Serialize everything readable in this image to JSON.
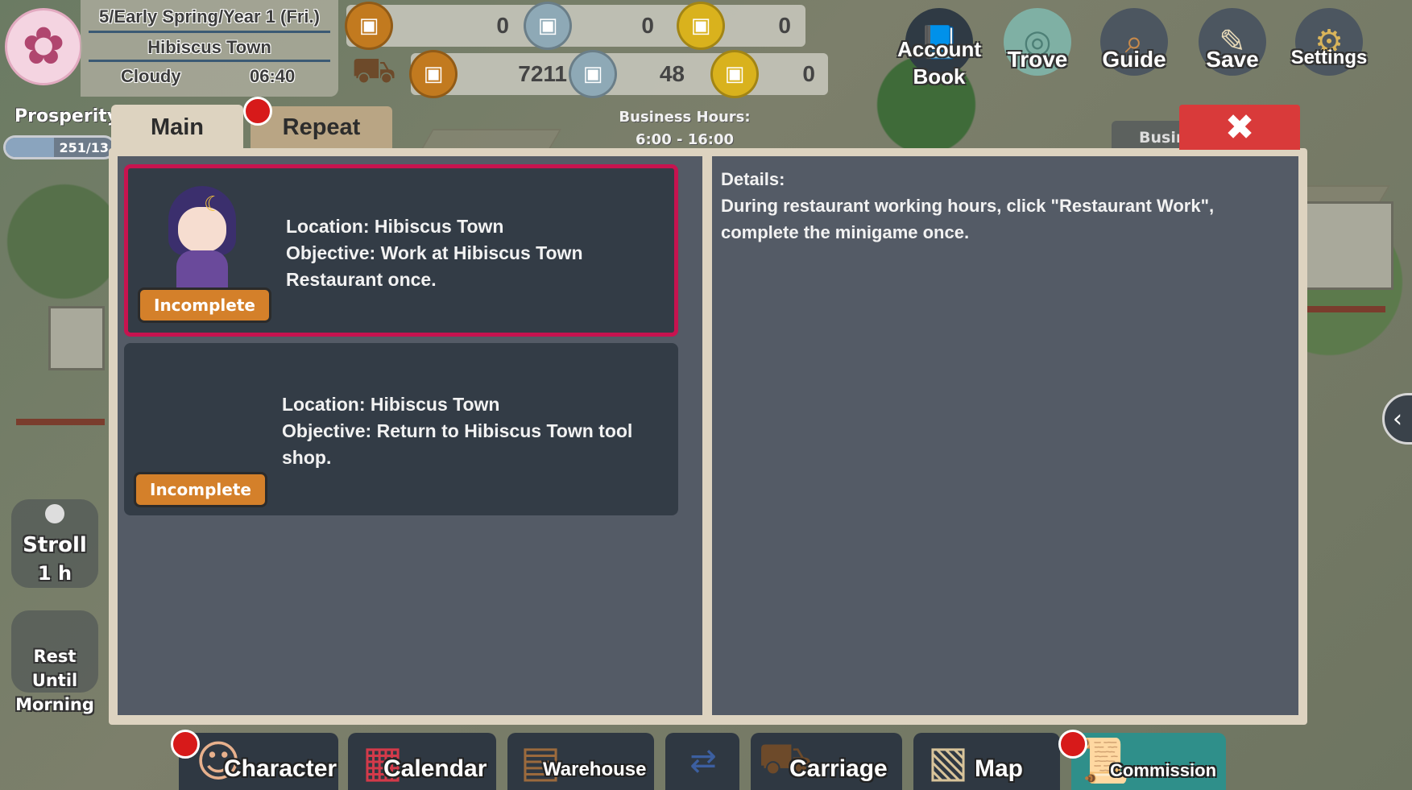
{
  "header": {
    "date": "5/Early Spring/Year 1 (Fri.)",
    "town": "Hibiscus Town",
    "weather": "Cloudy",
    "time": "06:40"
  },
  "currency": {
    "row1": [
      "0",
      "0",
      "0"
    ],
    "row2": [
      "7211",
      "48",
      "0"
    ]
  },
  "top_menu": {
    "account_book": "Account Book",
    "trove": "Trove",
    "guide": "Guide",
    "save": "Save",
    "settings": "Settings"
  },
  "prosperity": {
    "label": "Prosperity",
    "value": "251/13",
    "fraction": 0.45
  },
  "side": {
    "stroll": "Stroll",
    "stroll_duration": "1 h",
    "rest": "Rest Until Morning"
  },
  "business": {
    "title": "Business Hours:",
    "hours": "6:00 - 16:00",
    "partial": "Busin"
  },
  "tabs": {
    "main": "Main",
    "repeat": "Repeat"
  },
  "quests": [
    {
      "location": "Location: Hibiscus Town",
      "objective": "Objective: Work at Hibiscus Town Restaurant once.",
      "status": "Incomplete"
    },
    {
      "location": "Location: Hibiscus Town",
      "objective": "Objective: Return to Hibiscus Town tool shop.",
      "status": "Incomplete"
    }
  ],
  "details": {
    "title": "Details:",
    "body": "During restaurant working hours, click \"Restaurant Work\", complete the minigame once."
  },
  "bottom_menu": {
    "character": "Character",
    "calendar": "Calendar",
    "warehouse": "Warehouse",
    "carriage": "Carriage",
    "map": "Map",
    "commission": "Commission"
  },
  "colors": {
    "selected_border": "#c7134f",
    "status_tag": "#d4802a",
    "close_button": "#d93a3a",
    "notification_dot": "#d71a1a"
  }
}
